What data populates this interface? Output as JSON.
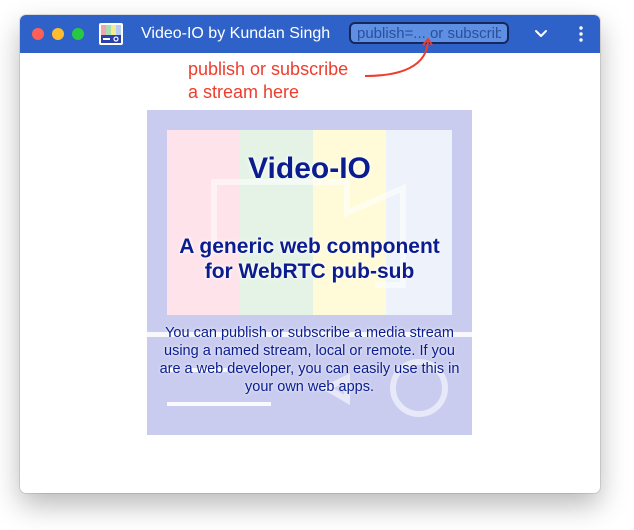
{
  "window": {
    "title": "Video-IO by Kundan Singh",
    "titlebar_color": "#2f62c9"
  },
  "toolbar": {
    "stream_input": {
      "value": "",
      "placeholder": "publish=... or subscribe=..."
    },
    "menu_icon": "chevron-down-icon",
    "more_icon": "vertical-dots-icon",
    "app_icon": "video-io-app-icon"
  },
  "hint": {
    "line1": "publish or subscribe",
    "line2": "a stream here",
    "color": "#ee3d2d"
  },
  "poster": {
    "title": "Video-IO",
    "subtitle_line1": "A generic web component",
    "subtitle_line2": "for WebRTC pub-sub",
    "description": "You can publish or subscribe a media stream using a named stream, local or remote. If you are a web developer, you can easily use this in your own web apps.",
    "text_color": "#0b1d8e",
    "stripe_colors": [
      "#ffe3ea",
      "#e5f3e6",
      "#fffbd8",
      "#edf2fb"
    ]
  }
}
